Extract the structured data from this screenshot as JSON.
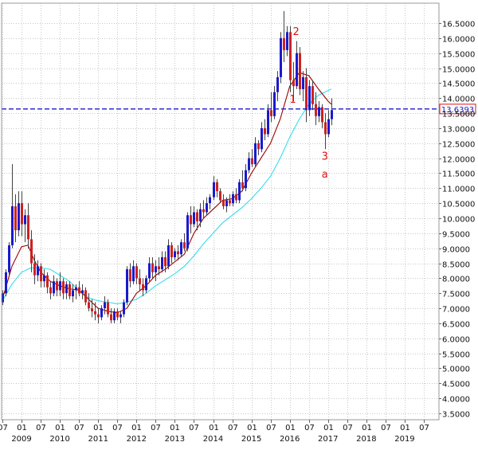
{
  "chart_data": {
    "type": "candlestick",
    "period": "monthly",
    "y_tick_labels": [
      "3.5000",
      "4.0000",
      "4.5000",
      "5.0000",
      "5.5000",
      "6.0000",
      "6.5000",
      "7.0000",
      "7.5000",
      "8.0000",
      "8.5000",
      "9.0000",
      "9.5000",
      "10.0000",
      "10.5000",
      "11.0000",
      "11.5000",
      "12.0000",
      "12.5000",
      "13.0000",
      "13.5000",
      "14.0000",
      "14.5000",
      "15.0000",
      "15.5000",
      "16.0000",
      "16.5000"
    ],
    "ylim": [
      3.3,
      17.0
    ],
    "x_month_ticks": [
      "07",
      "01",
      "07",
      "01",
      "07",
      "01",
      "07",
      "01",
      "07",
      "01",
      "07",
      "01",
      "07",
      "01",
      "07",
      "01",
      "07",
      "01",
      "07",
      "01",
      "07",
      "01",
      "07"
    ],
    "x_year_labels": [
      {
        "label": "2009",
        "month": "2009-01"
      },
      {
        "label": "2010",
        "month": "2010-01"
      },
      {
        "label": "2011",
        "month": "2011-01"
      },
      {
        "label": "2012",
        "month": "2012-01"
      },
      {
        "label": "2013",
        "month": "2013-01"
      },
      {
        "label": "2014",
        "month": "2014-01"
      },
      {
        "label": "2015",
        "month": "2015-01"
      },
      {
        "label": "2016",
        "month": "2016-01"
      },
      {
        "label": "2017",
        "month": "2017-01"
      },
      {
        "label": "2018",
        "month": "2018-01"
      },
      {
        "label": "2019",
        "month": "2019-01"
      }
    ],
    "x_first_tick_month": "2008-07",
    "x_last_tick_month": "2019-07",
    "current_price": {
      "value": 13.6393,
      "label": "13.6393"
    },
    "candles": [
      {
        "month": "2008-07",
        "o": 7.2,
        "h": 7.6,
        "l": 7.1,
        "c": 7.5
      },
      {
        "month": "2008-08",
        "o": 7.5,
        "h": 8.3,
        "l": 7.4,
        "c": 8.2
      },
      {
        "month": "2008-09",
        "o": 8.2,
        "h": 9.2,
        "l": 8.1,
        "c": 9.1
      },
      {
        "month": "2008-10",
        "o": 9.1,
        "h": 11.8,
        "l": 9.0,
        "c": 10.4
      },
      {
        "month": "2008-11",
        "o": 10.4,
        "h": 10.8,
        "l": 9.2,
        "c": 9.6
      },
      {
        "month": "2008-12",
        "o": 9.6,
        "h": 10.9,
        "l": 9.4,
        "c": 10.5
      },
      {
        "month": "2009-01",
        "o": 10.5,
        "h": 10.9,
        "l": 9.4,
        "c": 9.8
      },
      {
        "month": "2009-02",
        "o": 9.8,
        "h": 10.3,
        "l": 9.2,
        "c": 10.1
      },
      {
        "month": "2009-03",
        "o": 10.1,
        "h": 10.5,
        "l": 9.0,
        "c": 9.3
      },
      {
        "month": "2009-04",
        "o": 9.3,
        "h": 9.6,
        "l": 8.2,
        "c": 8.5
      },
      {
        "month": "2009-05",
        "o": 8.5,
        "h": 8.8,
        "l": 7.8,
        "c": 8.1
      },
      {
        "month": "2009-06",
        "o": 8.1,
        "h": 8.6,
        "l": 7.9,
        "c": 8.4
      },
      {
        "month": "2009-07",
        "o": 8.4,
        "h": 8.5,
        "l": 7.7,
        "c": 7.9
      },
      {
        "month": "2009-08",
        "o": 7.9,
        "h": 8.3,
        "l": 7.7,
        "c": 8.1
      },
      {
        "month": "2009-09",
        "o": 8.1,
        "h": 8.2,
        "l": 7.5,
        "c": 7.7
      },
      {
        "month": "2009-10",
        "o": 7.7,
        "h": 7.9,
        "l": 7.3,
        "c": 7.5
      },
      {
        "month": "2009-11",
        "o": 7.5,
        "h": 8.1,
        "l": 7.4,
        "c": 7.9
      },
      {
        "month": "2009-12",
        "o": 7.9,
        "h": 8.0,
        "l": 7.4,
        "c": 7.6
      },
      {
        "month": "2010-01",
        "o": 7.6,
        "h": 8.2,
        "l": 7.4,
        "c": 7.9
      },
      {
        "month": "2010-02",
        "o": 7.9,
        "h": 8.0,
        "l": 7.3,
        "c": 7.5
      },
      {
        "month": "2010-03",
        "o": 7.5,
        "h": 7.9,
        "l": 7.3,
        "c": 7.8
      },
      {
        "month": "2010-04",
        "o": 7.8,
        "h": 7.9,
        "l": 7.3,
        "c": 7.4
      },
      {
        "month": "2010-05",
        "o": 7.4,
        "h": 7.8,
        "l": 7.2,
        "c": 7.6
      },
      {
        "month": "2010-06",
        "o": 7.6,
        "h": 7.8,
        "l": 7.3,
        "c": 7.7
      },
      {
        "month": "2010-07",
        "o": 7.7,
        "h": 7.9,
        "l": 7.4,
        "c": 7.5
      },
      {
        "month": "2010-08",
        "o": 7.5,
        "h": 7.8,
        "l": 7.3,
        "c": 7.6
      },
      {
        "month": "2010-09",
        "o": 7.6,
        "h": 7.7,
        "l": 7.1,
        "c": 7.2
      },
      {
        "month": "2010-10",
        "o": 7.2,
        "h": 7.5,
        "l": 6.9,
        "c": 7.0
      },
      {
        "month": "2010-11",
        "o": 7.0,
        "h": 7.3,
        "l": 6.7,
        "c": 6.9
      },
      {
        "month": "2010-12",
        "o": 6.9,
        "h": 7.2,
        "l": 6.6,
        "c": 6.8
      },
      {
        "month": "2011-01",
        "o": 6.8,
        "h": 7.0,
        "l": 6.5,
        "c": 6.7
      },
      {
        "month": "2011-02",
        "o": 6.7,
        "h": 7.1,
        "l": 6.6,
        "c": 7.0
      },
      {
        "month": "2011-03",
        "o": 7.0,
        "h": 7.4,
        "l": 6.8,
        "c": 7.2
      },
      {
        "month": "2011-04",
        "o": 7.2,
        "h": 7.3,
        "l": 6.7,
        "c": 6.8
      },
      {
        "month": "2011-05",
        "o": 6.8,
        "h": 7.0,
        "l": 6.5,
        "c": 6.6
      },
      {
        "month": "2011-06",
        "o": 6.6,
        "h": 7.0,
        "l": 6.5,
        "c": 6.9
      },
      {
        "month": "2011-07",
        "o": 6.9,
        "h": 7.0,
        "l": 6.6,
        "c": 6.7
      },
      {
        "month": "2011-08",
        "o": 6.7,
        "h": 6.9,
        "l": 6.5,
        "c": 6.8
      },
      {
        "month": "2011-09",
        "o": 6.8,
        "h": 7.3,
        "l": 6.7,
        "c": 7.2
      },
      {
        "month": "2011-10",
        "o": 7.2,
        "h": 8.4,
        "l": 7.1,
        "c": 8.3
      },
      {
        "month": "2011-11",
        "o": 8.3,
        "h": 8.5,
        "l": 7.7,
        "c": 7.9
      },
      {
        "month": "2011-12",
        "o": 7.9,
        "h": 8.6,
        "l": 7.8,
        "c": 8.4
      },
      {
        "month": "2012-01",
        "o": 8.4,
        "h": 8.5,
        "l": 7.8,
        "c": 8.0
      },
      {
        "month": "2012-02",
        "o": 8.0,
        "h": 8.3,
        "l": 7.6,
        "c": 7.8
      },
      {
        "month": "2012-03",
        "o": 7.8,
        "h": 8.0,
        "l": 7.4,
        "c": 7.6
      },
      {
        "month": "2012-04",
        "o": 7.6,
        "h": 8.1,
        "l": 7.5,
        "c": 8.0
      },
      {
        "month": "2012-05",
        "o": 8.0,
        "h": 8.7,
        "l": 7.9,
        "c": 8.5
      },
      {
        "month": "2012-06",
        "o": 8.5,
        "h": 8.7,
        "l": 8.0,
        "c": 8.2
      },
      {
        "month": "2012-07",
        "o": 8.2,
        "h": 8.6,
        "l": 7.9,
        "c": 8.4
      },
      {
        "month": "2012-08",
        "o": 8.4,
        "h": 8.7,
        "l": 8.1,
        "c": 8.3
      },
      {
        "month": "2012-09",
        "o": 8.3,
        "h": 8.9,
        "l": 8.2,
        "c": 8.7
      },
      {
        "month": "2012-10",
        "o": 8.7,
        "h": 8.9,
        "l": 8.2,
        "c": 8.4
      },
      {
        "month": "2012-11",
        "o": 8.4,
        "h": 9.3,
        "l": 8.3,
        "c": 9.1
      },
      {
        "month": "2012-12",
        "o": 9.1,
        "h": 9.2,
        "l": 8.5,
        "c": 8.7
      },
      {
        "month": "2013-01",
        "o": 8.7,
        "h": 9.0,
        "l": 8.6,
        "c": 8.9
      },
      {
        "month": "2013-02",
        "o": 8.9,
        "h": 9.1,
        "l": 8.6,
        "c": 8.8
      },
      {
        "month": "2013-03",
        "o": 8.8,
        "h": 9.3,
        "l": 8.7,
        "c": 9.2
      },
      {
        "month": "2013-04",
        "o": 9.2,
        "h": 9.5,
        "l": 8.9,
        "c": 9.0
      },
      {
        "month": "2013-05",
        "o": 9.0,
        "h": 10.2,
        "l": 8.9,
        "c": 10.1
      },
      {
        "month": "2013-06",
        "o": 10.1,
        "h": 10.4,
        "l": 9.5,
        "c": 9.8
      },
      {
        "month": "2013-07",
        "o": 9.8,
        "h": 10.4,
        "l": 9.7,
        "c": 10.2
      },
      {
        "month": "2013-08",
        "o": 10.2,
        "h": 10.3,
        "l": 9.6,
        "c": 9.9
      },
      {
        "month": "2013-09",
        "o": 9.9,
        "h": 10.5,
        "l": 9.7,
        "c": 10.3
      },
      {
        "month": "2013-10",
        "o": 10.3,
        "h": 10.6,
        "l": 10.0,
        "c": 10.2
      },
      {
        "month": "2013-11",
        "o": 10.2,
        "h": 10.7,
        "l": 10.1,
        "c": 10.5
      },
      {
        "month": "2013-12",
        "o": 10.5,
        "h": 10.8,
        "l": 10.3,
        "c": 10.7
      },
      {
        "month": "2014-01",
        "o": 10.7,
        "h": 11.4,
        "l": 10.6,
        "c": 11.2
      },
      {
        "month": "2014-02",
        "o": 11.2,
        "h": 11.3,
        "l": 10.7,
        "c": 10.9
      },
      {
        "month": "2014-03",
        "o": 10.9,
        "h": 11.0,
        "l": 10.5,
        "c": 10.6
      },
      {
        "month": "2014-04",
        "o": 10.6,
        "h": 10.8,
        "l": 10.3,
        "c": 10.4
      },
      {
        "month": "2014-05",
        "o": 10.4,
        "h": 10.7,
        "l": 10.2,
        "c": 10.6
      },
      {
        "month": "2014-06",
        "o": 10.6,
        "h": 10.8,
        "l": 10.4,
        "c": 10.5
      },
      {
        "month": "2014-07",
        "o": 10.5,
        "h": 10.9,
        "l": 10.4,
        "c": 10.8
      },
      {
        "month": "2014-08",
        "o": 10.8,
        "h": 11.0,
        "l": 10.5,
        "c": 10.6
      },
      {
        "month": "2014-09",
        "o": 10.6,
        "h": 11.3,
        "l": 10.5,
        "c": 11.2
      },
      {
        "month": "2014-10",
        "o": 11.2,
        "h": 11.6,
        "l": 10.9,
        "c": 11.0
      },
      {
        "month": "2014-11",
        "o": 11.0,
        "h": 11.8,
        "l": 10.9,
        "c": 11.6
      },
      {
        "month": "2014-12",
        "o": 11.6,
        "h": 12.2,
        "l": 11.5,
        "c": 12.0
      },
      {
        "month": "2015-01",
        "o": 12.0,
        "h": 12.3,
        "l": 11.7,
        "c": 11.8
      },
      {
        "month": "2015-02",
        "o": 11.8,
        "h": 12.7,
        "l": 11.7,
        "c": 12.5
      },
      {
        "month": "2015-03",
        "o": 12.5,
        "h": 12.6,
        "l": 12.1,
        "c": 12.3
      },
      {
        "month": "2015-04",
        "o": 12.3,
        "h": 13.2,
        "l": 12.2,
        "c": 13.0
      },
      {
        "month": "2015-05",
        "o": 13.0,
        "h": 13.3,
        "l": 12.6,
        "c": 12.8
      },
      {
        "month": "2015-06",
        "o": 12.8,
        "h": 13.8,
        "l": 12.7,
        "c": 13.6
      },
      {
        "month": "2015-07",
        "o": 13.6,
        "h": 14.2,
        "l": 13.2,
        "c": 13.4
      },
      {
        "month": "2015-08",
        "o": 13.4,
        "h": 14.4,
        "l": 13.3,
        "c": 14.2
      },
      {
        "month": "2015-09",
        "o": 14.2,
        "h": 14.9,
        "l": 13.9,
        "c": 14.7
      },
      {
        "month": "2015-10",
        "o": 14.7,
        "h": 16.2,
        "l": 14.5,
        "c": 16.0
      },
      {
        "month": "2015-11",
        "o": 16.0,
        "h": 16.9,
        "l": 15.2,
        "c": 15.6
      },
      {
        "month": "2015-12",
        "o": 15.6,
        "h": 16.4,
        "l": 15.4,
        "c": 16.2
      },
      {
        "month": "2016-01",
        "o": 16.2,
        "h": 16.4,
        "l": 14.2,
        "c": 14.6
      },
      {
        "month": "2016-02",
        "o": 14.6,
        "h": 15.2,
        "l": 13.9,
        "c": 14.4
      },
      {
        "month": "2016-03",
        "o": 14.4,
        "h": 15.9,
        "l": 14.3,
        "c": 15.5
      },
      {
        "month": "2016-04",
        "o": 15.5,
        "h": 15.7,
        "l": 14.1,
        "c": 14.3
      },
      {
        "month": "2016-05",
        "o": 14.3,
        "h": 14.9,
        "l": 13.9,
        "c": 14.7
      },
      {
        "month": "2016-06",
        "o": 14.7,
        "h": 15.0,
        "l": 13.2,
        "c": 13.6
      },
      {
        "month": "2016-07",
        "o": 13.6,
        "h": 14.6,
        "l": 13.4,
        "c": 14.4
      },
      {
        "month": "2016-08",
        "o": 14.4,
        "h": 14.6,
        "l": 13.6,
        "c": 13.8
      },
      {
        "month": "2016-09",
        "o": 13.8,
        "h": 14.2,
        "l": 13.1,
        "c": 13.4
      },
      {
        "month": "2016-10",
        "o": 13.4,
        "h": 13.9,
        "l": 13.2,
        "c": 13.7
      },
      {
        "month": "2016-11",
        "o": 13.7,
        "h": 13.8,
        "l": 13.0,
        "c": 13.2
      },
      {
        "month": "2016-12",
        "o": 13.2,
        "h": 13.5,
        "l": 12.3,
        "c": 12.8
      },
      {
        "month": "2017-01",
        "o": 12.8,
        "h": 13.6,
        "l": 12.7,
        "c": 13.3
      },
      {
        "month": "2017-02",
        "o": 13.3,
        "h": 14.0,
        "l": 13.1,
        "c": 13.6
      }
    ],
    "sma_red": [
      [
        "2008-07",
        7.3
      ],
      [
        "2008-10",
        8.4
      ],
      [
        "2009-01",
        9.05
      ],
      [
        "2009-03",
        9.1
      ],
      [
        "2009-05",
        8.6
      ],
      [
        "2009-07",
        8.2
      ],
      [
        "2009-10",
        7.9
      ],
      [
        "2010-01",
        7.75
      ],
      [
        "2010-04",
        7.65
      ],
      [
        "2010-07",
        7.6
      ],
      [
        "2010-10",
        7.3
      ],
      [
        "2011-01",
        7.0
      ],
      [
        "2011-04",
        6.9
      ],
      [
        "2011-07",
        6.85
      ],
      [
        "2011-10",
        7.0
      ],
      [
        "2012-01",
        7.5
      ],
      [
        "2012-04",
        7.75
      ],
      [
        "2012-07",
        8.1
      ],
      [
        "2012-10",
        8.3
      ],
      [
        "2013-01",
        8.55
      ],
      [
        "2013-04",
        8.8
      ],
      [
        "2013-07",
        9.5
      ],
      [
        "2013-10",
        10.0
      ],
      [
        "2014-01",
        10.3
      ],
      [
        "2014-04",
        10.6
      ],
      [
        "2014-07",
        10.65
      ],
      [
        "2014-10",
        10.9
      ],
      [
        "2015-01",
        11.5
      ],
      [
        "2015-04",
        12.0
      ],
      [
        "2015-07",
        12.5
      ],
      [
        "2015-10",
        13.3
      ],
      [
        "2016-01",
        14.4
      ],
      [
        "2016-04",
        14.85
      ],
      [
        "2016-07",
        14.75
      ],
      [
        "2016-10",
        14.3
      ],
      [
        "2017-01",
        13.9
      ],
      [
        "2017-02",
        13.8
      ]
    ],
    "sma_cyan": [
      [
        "2008-07",
        7.25
      ],
      [
        "2008-10",
        7.8
      ],
      [
        "2009-01",
        8.2
      ],
      [
        "2009-04",
        8.35
      ],
      [
        "2009-07",
        8.35
      ],
      [
        "2009-10",
        8.3
      ],
      [
        "2010-01",
        8.1
      ],
      [
        "2010-04",
        7.9
      ],
      [
        "2010-07",
        7.6
      ],
      [
        "2010-10",
        7.35
      ],
      [
        "2011-01",
        7.25
      ],
      [
        "2011-04",
        7.2
      ],
      [
        "2011-07",
        7.15
      ],
      [
        "2011-10",
        7.2
      ],
      [
        "2012-01",
        7.3
      ],
      [
        "2012-04",
        7.5
      ],
      [
        "2012-07",
        7.75
      ],
      [
        "2012-10",
        7.95
      ],
      [
        "2013-01",
        8.15
      ],
      [
        "2013-04",
        8.4
      ],
      [
        "2013-07",
        8.75
      ],
      [
        "2013-10",
        9.15
      ],
      [
        "2014-01",
        9.5
      ],
      [
        "2014-04",
        9.85
      ],
      [
        "2014-07",
        10.1
      ],
      [
        "2014-10",
        10.35
      ],
      [
        "2015-01",
        10.65
      ],
      [
        "2015-04",
        11.0
      ],
      [
        "2015-07",
        11.4
      ],
      [
        "2015-10",
        12.0
      ],
      [
        "2016-01",
        12.7
      ],
      [
        "2016-04",
        13.3
      ],
      [
        "2016-07",
        13.8
      ],
      [
        "2016-10",
        14.1
      ],
      [
        "2017-01",
        14.25
      ],
      [
        "2017-02",
        14.3
      ]
    ],
    "annotations": [
      {
        "text": "1",
        "month": "2016-02",
        "value": 13.85
      },
      {
        "text": "2",
        "month": "2016-03",
        "value": 16.1
      },
      {
        "text": "3",
        "month": "2016-12",
        "value": 11.95
      },
      {
        "text": "a",
        "month": "2016-12",
        "value": 11.35
      }
    ],
    "grid": true,
    "colors": {
      "bull": "#1a1acc",
      "bear": "#cc2222",
      "wick": "#444444",
      "sma_red": "#990000",
      "sma_cyan": "#33ddee",
      "current_line": "#1a1acc",
      "annotation": "#dd1111",
      "grid": "#c8c8c8"
    }
  }
}
